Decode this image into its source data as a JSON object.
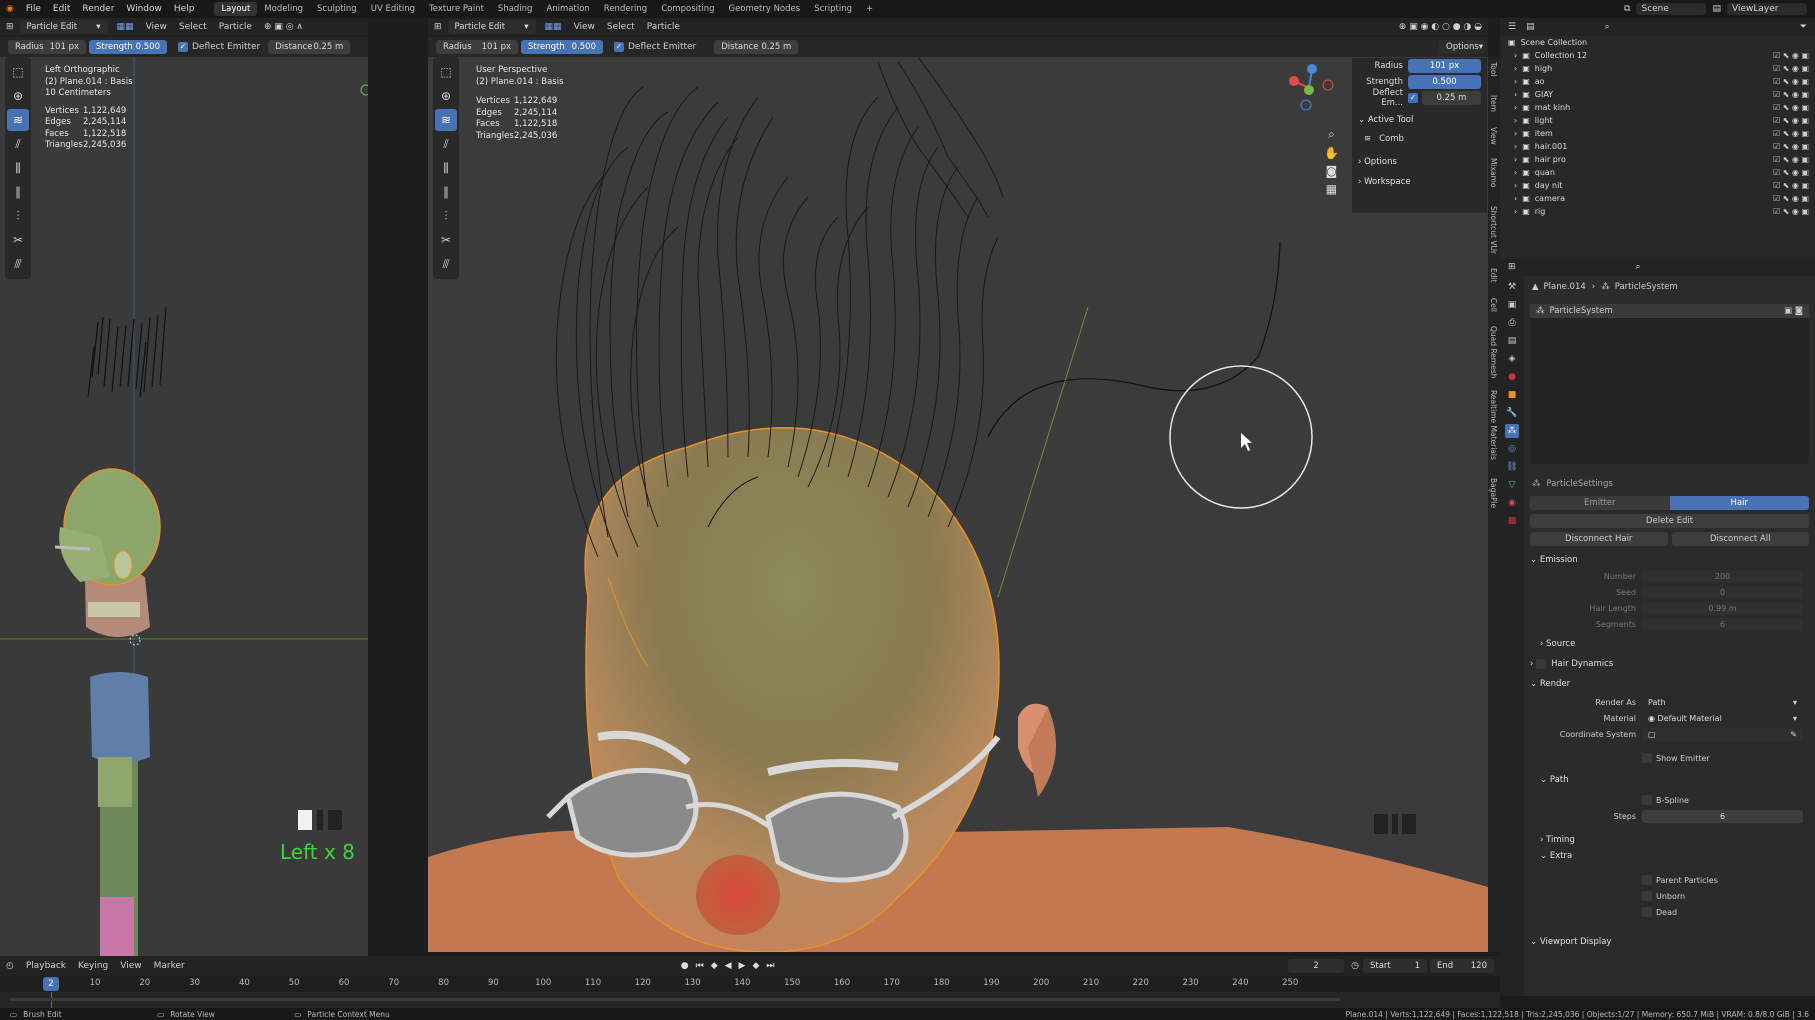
{
  "menu": [
    "File",
    "Edit",
    "Render",
    "Window",
    "Help"
  ],
  "workspaces": [
    "Layout",
    "Modeling",
    "Sculpting",
    "UV Editing",
    "Texture Paint",
    "Shading",
    "Animation",
    "Rendering",
    "Compositing",
    "Geometry Nodes",
    "Scripting",
    "+"
  ],
  "top_right": {
    "scene": "Scene",
    "view_layer": "ViewLayer"
  },
  "left_header": {
    "mode": "Particle Edit",
    "menus": [
      "View",
      "Select",
      "Particle"
    ]
  },
  "main_header": {
    "mode": "Particle Edit",
    "menus": [
      "View",
      "Select",
      "Particle"
    ],
    "options": "Options"
  },
  "tool_settings": {
    "radius_label": "Radius",
    "radius": "101 px",
    "strength_label": "Strength",
    "strength": "0.500",
    "deflect_emitter": "Deflect Emitter",
    "distance_label": "Distance",
    "distance": "0.25 m"
  },
  "left_viewport": {
    "view": "Left Orthographic",
    "object": "(2) Plane.014 : Basis",
    "scale": "10 Centimeters",
    "stats": [
      {
        "label": "Vertices",
        "value": "1,122,649"
      },
      {
        "label": "Edges",
        "value": "2,245,114"
      },
      {
        "label": "Faces",
        "value": "1,122,518"
      },
      {
        "label": "Triangles",
        "value": "2,245,036"
      }
    ],
    "keystroke": "Left x 8"
  },
  "main_viewport": {
    "view": "User Perspective",
    "object": "(2) Plane.014 : Basis",
    "stats": [
      {
        "label": "Vertices",
        "value": "1,122,649"
      },
      {
        "label": "Edges",
        "value": "2,245,114"
      },
      {
        "label": "Faces",
        "value": "1,122,518"
      },
      {
        "label": "Triangles",
        "value": "2,245,036"
      }
    ]
  },
  "npanel": {
    "radius_label": "Radius",
    "radius": "101 px",
    "strength_label": "Strength",
    "strength": "0.500",
    "deflect_label": "Deflect Em...",
    "deflect_value": "0.25 m",
    "active_tool": "Active Tool",
    "tool_name": "Comb",
    "options": "Options",
    "workspace": "Workspace",
    "tabs": [
      "Tool",
      "Item",
      "View",
      "Mixamo",
      "Shortcut VUr",
      "Edit",
      "Cell",
      "Quad Remesh",
      "Realtime Materials",
      "BagaPie"
    ]
  },
  "outliner": {
    "root": "Scene Collection",
    "items": [
      "Collection 12",
      "high",
      "ao",
      "GIAY",
      "mat kinh",
      "light",
      "item",
      "hair.001",
      "hair pro",
      "quan",
      "day nit",
      "camera",
      "rig"
    ]
  },
  "properties": {
    "breadcrumb_obj": "Plane.014",
    "breadcrumb_sys": "ParticleSystem",
    "system": "ParticleSystem",
    "settings": "ParticleSettings",
    "tab_emitter": "Emitter",
    "tab_hair": "Hair",
    "delete_edit": "Delete Edit",
    "disconnect_hair": "Disconnect Hair",
    "disconnect_all": "Disconnect All",
    "emission": "Emission",
    "number_label": "Number",
    "number": "200",
    "seed_label": "Seed",
    "seed": "0",
    "hair_length_label": "Hair Length",
    "hair_length": "0.99 m",
    "segments_label": "Segments",
    "segments": "6",
    "source": "Source",
    "hair_dynamics": "Hair Dynamics",
    "render": "Render",
    "render_as_label": "Render As",
    "render_as": "Path",
    "material_label": "Material",
    "material": "Default Material",
    "coord_label": "Coordinate System",
    "show_emitter": "Show Emitter",
    "path": "Path",
    "bspline": "B-Spline",
    "steps_label": "Steps",
    "steps": "6",
    "timing": "Timing",
    "extra": "Extra",
    "parent_particles": "Parent Particles",
    "unborn": "Unborn",
    "dead": "Dead",
    "viewport_display": "Viewport Display"
  },
  "timeline": {
    "menus": [
      "Playback",
      "Keying",
      "View",
      "Marker"
    ],
    "current": "2",
    "start_label": "Start",
    "start": "1",
    "end_label": "End",
    "end": "120",
    "ticks": [
      "10",
      "20",
      "30",
      "40",
      "50",
      "60",
      "70",
      "80",
      "90",
      "100",
      "110",
      "120",
      "130",
      "140",
      "150",
      "160",
      "170",
      "180",
      "190",
      "200",
      "210",
      "220",
      "230",
      "240",
      "250"
    ],
    "frame_marker": "2"
  },
  "statusbar": {
    "left1": "Brush Edit",
    "left2": "Rotate View",
    "left3": "Particle Context Menu",
    "right": "Plane.014 | Verts:1,122,649 | Faces:1,122,518 | Tris:2,245,036 | Objects:1/27 | Memory: 650.7 MiB | VRAM: 0.8/8.0 GiB | 3.6"
  },
  "colors": {
    "accent": "#4772b3",
    "keystroke": "#3cd63c",
    "selection": "#e8912d"
  }
}
